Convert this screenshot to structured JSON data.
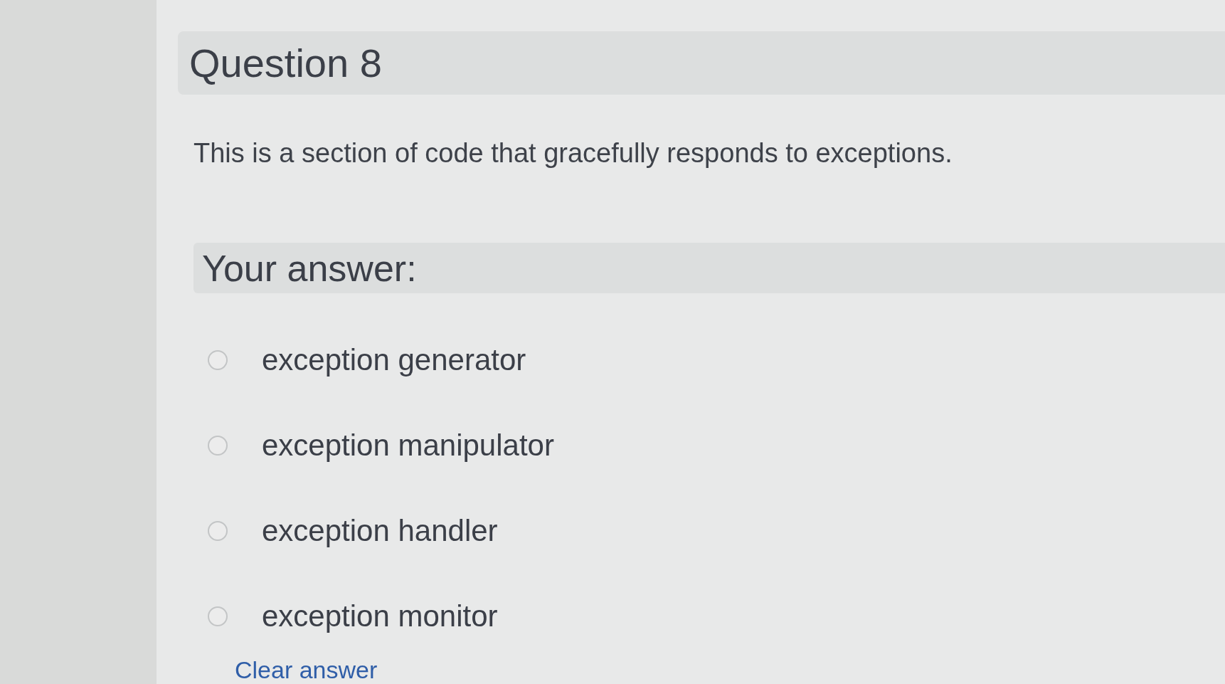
{
  "question": {
    "title": "Question 8",
    "text": "This is a section of code that gracefully responds to exceptions."
  },
  "answer": {
    "label": "Your answer:",
    "options": [
      {
        "label": "exception generator",
        "selected": false
      },
      {
        "label": "exception manipulator",
        "selected": false
      },
      {
        "label": "exception handler",
        "selected": false
      },
      {
        "label": "exception monitor",
        "selected": false
      }
    ],
    "clear_link": "Clear answer"
  }
}
